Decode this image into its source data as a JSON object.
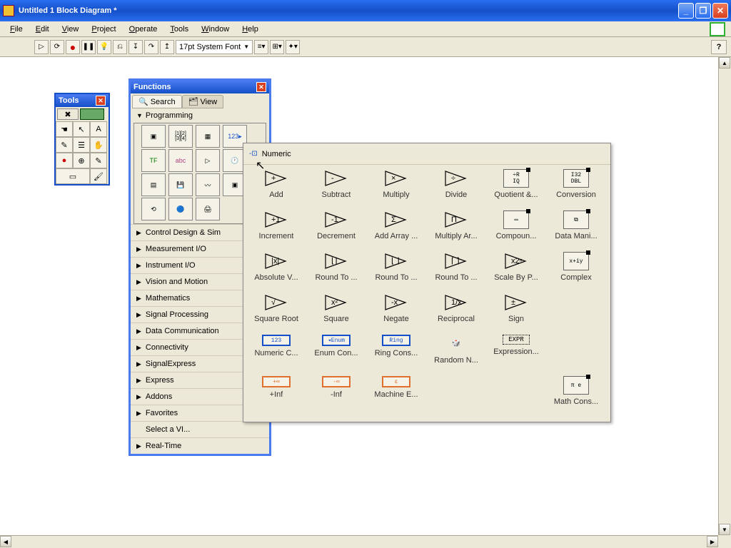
{
  "window": {
    "title": "Untitled 1 Block Diagram *"
  },
  "menu": [
    "File",
    "Edit",
    "View",
    "Project",
    "Operate",
    "Tools",
    "Window",
    "Help"
  ],
  "toolbar": {
    "font": "17pt System Font"
  },
  "tools_palette": {
    "title": "Tools"
  },
  "functions_palette": {
    "title": "Functions",
    "tabs": {
      "search": "Search",
      "view": "View"
    },
    "programming": "Programming",
    "categories": [
      "Control Design & Sim",
      "Measurement I/O",
      "Instrument I/O",
      "Vision and Motion",
      "Mathematics",
      "Signal Processing",
      "Data Communication",
      "Connectivity",
      "SignalExpress",
      "Express",
      "Addons",
      "Favorites",
      "Select a VI...",
      "Real-Time"
    ]
  },
  "numeric_flyout": {
    "title": "Numeric",
    "items": [
      {
        "label": "Add",
        "sym": "+"
      },
      {
        "label": "Subtract",
        "sym": "-"
      },
      {
        "label": "Multiply",
        "sym": "×"
      },
      {
        "label": "Divide",
        "sym": "÷"
      },
      {
        "label": "Quotient &...",
        "sym": "÷R\nIQ",
        "box": true
      },
      {
        "label": "Conversion",
        "sym": "I32\nDBL",
        "box": true
      },
      {
        "label": "Increment",
        "sym": "+1"
      },
      {
        "label": "Decrement",
        "sym": "-1"
      },
      {
        "label": "Add Array ...",
        "sym": "Σ"
      },
      {
        "label": "Multiply Ar...",
        "sym": "Π"
      },
      {
        "label": "Compoun...",
        "sym": "▭",
        "box": true
      },
      {
        "label": "Data Mani...",
        "sym": "⧉",
        "box": true
      },
      {
        "label": "Absolute V...",
        "sym": "|x|"
      },
      {
        "label": "Round To ...",
        "sym": "⌊⌉"
      },
      {
        "label": "Round To ...",
        "sym": "⌊ ⌋"
      },
      {
        "label": "Round To ...",
        "sym": "⌈ ⌉"
      },
      {
        "label": "Scale By P...",
        "sym": "x2ⁿ"
      },
      {
        "label": "Complex",
        "sym": "x+iy",
        "box": true
      },
      {
        "label": "Square Root",
        "sym": "√"
      },
      {
        "label": "Square",
        "sym": "x²"
      },
      {
        "label": "Negate",
        "sym": "-x"
      },
      {
        "label": "Reciprocal",
        "sym": "1/x"
      },
      {
        "label": "Sign",
        "sym": "±"
      },
      {
        "label": "",
        "sym": "",
        "empty": true
      },
      {
        "label": "Numeric C...",
        "sym": "123",
        "const": true,
        "color": "#1550c8"
      },
      {
        "label": "Enum Con...",
        "sym": "◂Enum",
        "const": true,
        "color": "#1550c8"
      },
      {
        "label": "Ring Cons...",
        "sym": "Ring",
        "const": true,
        "color": "#1550c8"
      },
      {
        "label": "Random N...",
        "sym": "🎲",
        "plain": true
      },
      {
        "label": "Expression...",
        "sym": "EXPR",
        "plain": true,
        "mono": true
      },
      {
        "label": "",
        "sym": "",
        "empty": true
      },
      {
        "label": "+Inf",
        "sym": "+∞",
        "const": true,
        "color": "#e07030"
      },
      {
        "label": "-Inf",
        "sym": "-∞",
        "const": true,
        "color": "#e07030"
      },
      {
        "label": "Machine E...",
        "sym": "ε",
        "const": true,
        "color": "#e07030"
      },
      {
        "label": "",
        "sym": "",
        "empty": true
      },
      {
        "label": "",
        "sym": "",
        "empty": true
      },
      {
        "label": "Math Cons...",
        "sym": "π e",
        "box": true
      }
    ]
  }
}
